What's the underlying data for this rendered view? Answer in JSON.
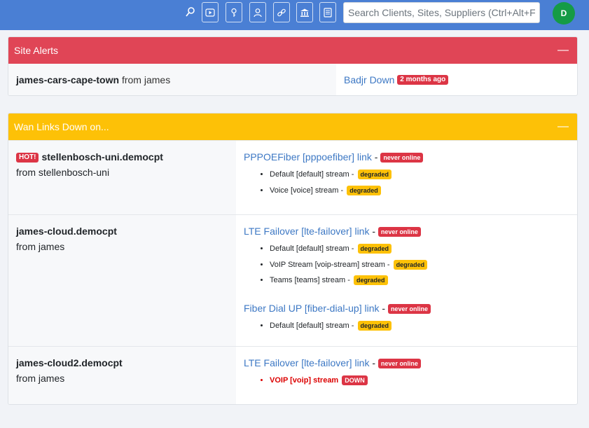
{
  "header": {
    "search_placeholder": "Search Clients, Sites, Suppliers (Ctrl+Alt+F)",
    "avatar_initial": "D",
    "icons": [
      "search-icon",
      "video-icon",
      "key-icon",
      "user-icon",
      "link-icon",
      "bank-icon",
      "list-icon"
    ]
  },
  "site_alerts": {
    "title": "Site Alerts",
    "collapse": "—",
    "site": "james-cars-cape-town",
    "from": "from james",
    "alert_link": "Badjr Down",
    "alert_age": "2 months ago"
  },
  "wan": {
    "title": "Wan Links Down on...",
    "collapse": "—",
    "sites": [
      {
        "hot": "HOT!",
        "name": "stellenbosch-uni.democpt",
        "from": "from stellenbosch-uni",
        "links": [
          {
            "name": "PPPOEFiber [pppoefiber] link",
            "sep": "-",
            "status": "never online",
            "streams": [
              {
                "label": "Default [default] stream -",
                "status": "degraded"
              },
              {
                "label": "Voice [voice] stream -",
                "status": "degraded"
              }
            ]
          }
        ]
      },
      {
        "name": "james-cloud.democpt",
        "from": "from james",
        "links": [
          {
            "name": "LTE Failover [lte-failover] link",
            "sep": "-",
            "status": "never online",
            "streams": [
              {
                "label": "Default [default] stream -",
                "status": "degraded"
              },
              {
                "label": "VoIP Stream [voip-stream] stream -",
                "status": "degraded"
              },
              {
                "label": "Teams [teams] stream -",
                "status": "degraded"
              }
            ]
          },
          {
            "name": "Fiber Dial UP [fiber-dial-up] link",
            "sep": "-",
            "status": "never online",
            "streams": [
              {
                "label": "Default [default] stream -",
                "status": "degraded"
              }
            ]
          }
        ]
      },
      {
        "name": "james-cloud2.democpt",
        "from": "from james",
        "links": [
          {
            "name": "LTE Failover [lte-failover] link",
            "sep": "-",
            "status": "never online",
            "streams": [
              {
                "label": "VOIP [voip] stream",
                "status": "DOWN"
              }
            ]
          }
        ]
      }
    ]
  },
  "colors": {
    "topbar": "#4a7fd4",
    "alert_header": "#e04556",
    "wan_header": "#fdc107",
    "link": "#3d78c4",
    "badge_red": "#dc3545",
    "badge_yellow": "#fdc107",
    "avatar": "#159b46"
  }
}
